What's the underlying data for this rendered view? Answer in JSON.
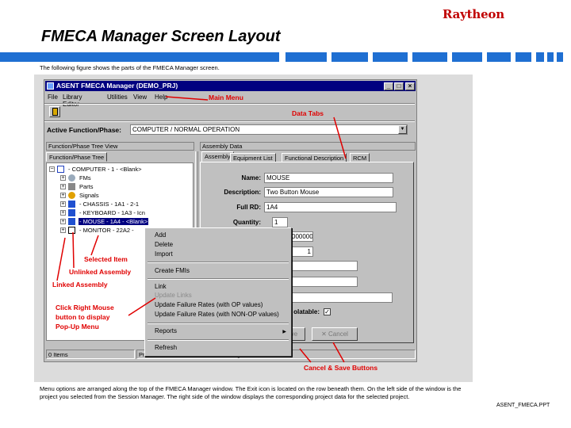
{
  "slide": {
    "logo": "Raytheon",
    "title": "FMECA Manager Screen Layout",
    "intro": "The following figure shows the parts of the FMECA Manager screen.",
    "footer_text": "Menu options are arranged along the top of the FMECA Manager window.  The Exit icon is located on the row beneath them.  On the left side of the window is the project you selected from the Session Manager.  The right side of the window displays the corresponding project data for the selected project.",
    "footer_id": "ASENT_FMECA.PPT",
    "accent_color": "#1f6fd2"
  },
  "window": {
    "title": "ASENT FMECA Manager (DEMO_PRJ)",
    "controls": [
      "_",
      "□",
      "×"
    ],
    "menu": [
      "File",
      "Library Editor",
      "Utilities",
      "View",
      "Help"
    ],
    "exit_icon": "exit-door-icon",
    "active_function_label": "Active Function/Phase:",
    "active_function_value": "COMPUTER / NORMAL OPERATION"
  },
  "left_pane": {
    "header": "Function/Phase Tree View",
    "tab": "Function/Phase Tree",
    "tree": [
      {
        "label": "- COMPUTER - 1 - <Blank>",
        "icon": "computer-icon",
        "selected": false
      },
      {
        "label": "FMs",
        "icon": "fm-icon",
        "selected": false
      },
      {
        "label": "Parts",
        "icon": "parts-icon",
        "selected": false
      },
      {
        "label": "Signals",
        "icon": "signals-icon",
        "selected": false
      },
      {
        "label": "- CHASSIS - 1A1 - 2-1",
        "icon": "assembly-icon",
        "selected": false
      },
      {
        "label": "- KEYBOARD - 1A3 - Icn",
        "icon": "assembly-icon",
        "selected": false
      },
      {
        "label": "- MOUSE - 1A4 - <Blank>",
        "icon": "assembly-icon",
        "selected": true
      },
      {
        "label": "- MONITOR - 22A2 -",
        "icon": "linked-assembly-icon",
        "selected": false
      }
    ]
  },
  "right_pane": {
    "header": "Assembly Data",
    "tabs": [
      "Assembly",
      "Equipment List",
      "Functional Description",
      "RCM"
    ],
    "fields": [
      {
        "label": "Name:",
        "value": "MOUSE"
      },
      {
        "label": "Description:",
        "value": "Two Button Mouse"
      },
      {
        "label": "Full RD:",
        "value": "1A4"
      },
      {
        "label": "Quantity:",
        "value": "1"
      }
    ],
    "partial_values": [
      "000000",
      "1"
    ],
    "isolatable_label": "olatable:",
    "isolatable_checked": "✓",
    "save_button": "ve",
    "cancel_button": "Cancel"
  },
  "status_bar": {
    "items": "0 Items",
    "hint": "Press the Save button to record changes."
  },
  "popup_menu": {
    "items": [
      {
        "label": "Add",
        "disabled": false
      },
      {
        "label": "Delete",
        "disabled": false
      },
      {
        "label": "Import",
        "disabled": false
      },
      {
        "label": "Create FMIs",
        "disabled": false
      },
      {
        "label": "Link",
        "disabled": false
      },
      {
        "label": "Update Links",
        "disabled": true
      },
      {
        "label": "Update Failure Rates (with OP values)",
        "disabled": false
      },
      {
        "label": "Update Failure Rates (with NON-OP values)",
        "disabled": false
      },
      {
        "label": "Reports",
        "disabled": false
      },
      {
        "label": "Refresh",
        "disabled": false
      }
    ]
  },
  "callouts": {
    "main_menu": "Main Menu",
    "data_tabs": "Data Tabs",
    "selected_item": "Selected Item",
    "unlinked_assembly": "Unlinked Assembly",
    "linked_assembly": "Linked Assembly",
    "right_click_1": "Click Right Mouse",
    "right_click_2": "button to display",
    "right_click_3": "Pop-Up Menu",
    "cancel_save": "Cancel & Save Buttons",
    "color": "#e00000"
  }
}
